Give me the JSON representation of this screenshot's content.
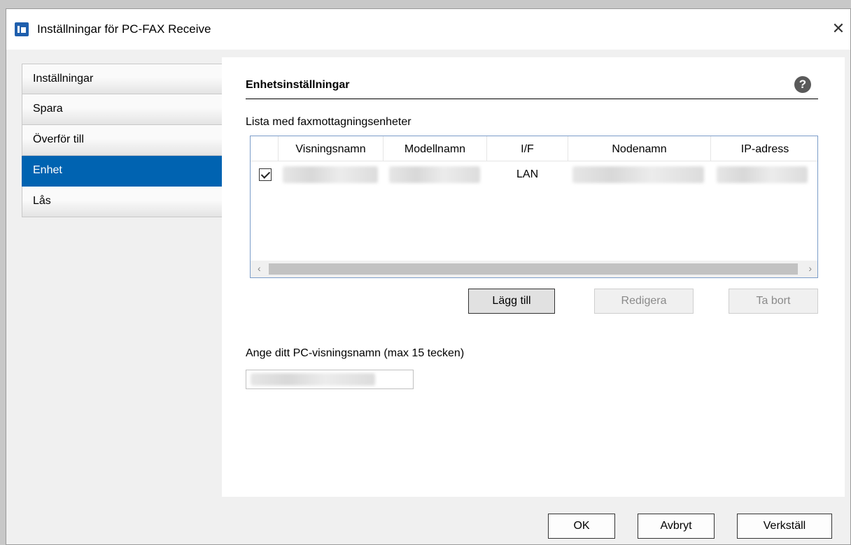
{
  "window": {
    "title": "Inställningar för PC-FAX Receive",
    "close_glyph": "✕"
  },
  "sidebar": {
    "items": [
      {
        "label": "Inställningar",
        "active": false
      },
      {
        "label": "Spara",
        "active": false
      },
      {
        "label": "Överför till",
        "active": false
      },
      {
        "label": "Enhet",
        "active": true
      },
      {
        "label": "Lås",
        "active": false
      }
    ]
  },
  "main": {
    "section_title": "Enhetsinställningar",
    "help_glyph": "?",
    "list_label": "Lista med faxmottagningsenheter",
    "table": {
      "columns": [
        "Visningsnamn",
        "Modellnamn",
        "I/F",
        "Nodenamn",
        "IP-adress"
      ],
      "rows": [
        {
          "checked": true,
          "interface": "LAN"
        }
      ]
    },
    "scroll_left": "‹",
    "scroll_right": "›",
    "buttons": {
      "add": "Lägg till",
      "edit": "Redigera",
      "remove": "Ta bort"
    },
    "pc_name_label": "Ange ditt PC-visningsnamn (max 15 tecken)"
  },
  "footer": {
    "ok": "OK",
    "cancel": "Avbryt",
    "apply": "Verkställ"
  },
  "colors": {
    "accent": "#0063b1",
    "table_border": "#7a9cc8"
  }
}
